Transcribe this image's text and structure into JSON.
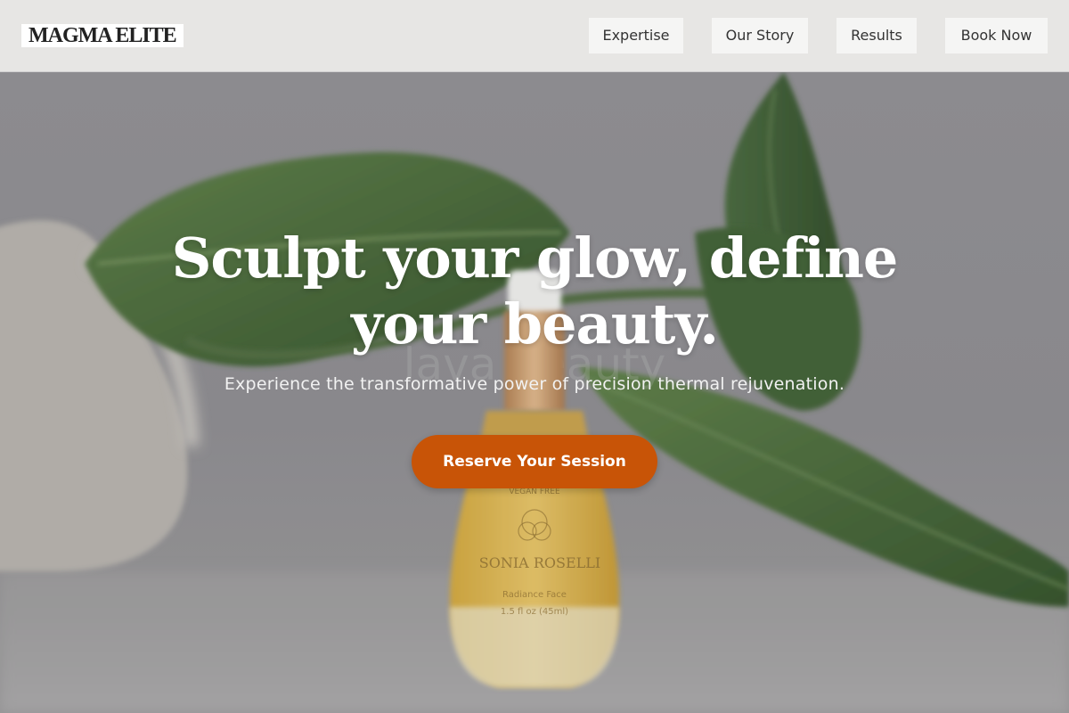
{
  "brand": {
    "logo_text": "MAGMA ELITE"
  },
  "nav": {
    "items": [
      {
        "label": "Expertise"
      },
      {
        "label": "Our Story"
      },
      {
        "label": "Results"
      },
      {
        "label": "Book Now"
      }
    ]
  },
  "hero": {
    "headline_line1": "Sculpt your glow, define",
    "headline_line2": "your beauty.",
    "subtitle": "Experience the transformative power of precision thermal rejuvenation.",
    "cta_label": "Reserve Your Session",
    "background_text": "lava beauty",
    "product_label_brand": "SONIA ROSELLI",
    "product_label_tagline": "VEGAN FREE",
    "product_label_line": "Radiance Face",
    "product_label_volume": "1.5 fl oz (45ml)"
  },
  "colors": {
    "header_bg": "#e7e6e4",
    "nav_button_bg": "#f5f5f4",
    "cta_bg": "#c85407",
    "hero_text": "#ffffff"
  },
  "icons": []
}
